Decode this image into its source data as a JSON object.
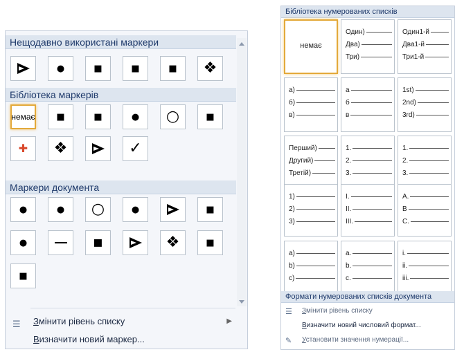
{
  "bullets": {
    "recent_header": "Нещодавно використані маркери",
    "library_header": "Бібліотека маркерів",
    "document_header": "Маркери документа",
    "none_label": "немає",
    "recent": [
      "triangle-open",
      "dot",
      "square",
      "square",
      "square",
      "diamond-cluster"
    ],
    "library": [
      "none",
      "square",
      "square",
      "dot",
      "circle",
      "square",
      "picture",
      "diamond-cluster",
      "triangle-open",
      "check"
    ],
    "document": [
      "dot",
      "dot",
      "circle",
      "dot",
      "triangle-open",
      "square",
      "dot",
      "dash",
      "small-square",
      "triangle-open",
      "diamond-cluster",
      "square",
      "square"
    ],
    "menu": {
      "change_level": {
        "underline": "З",
        "rest": "мінити рівень списку"
      },
      "define_new": {
        "underline": "В",
        "rest": "изначити новий маркер..."
      }
    }
  },
  "numbering": {
    "library_header": "Бібліотека нумерованих списків",
    "none_label": "немає",
    "formats_header": "Формати нумерованих списків документа",
    "cells": [
      {
        "type": "none"
      },
      {
        "type": "list",
        "lines": [
          "Один)",
          "Два)",
          "Три)"
        ]
      },
      {
        "type": "list",
        "lines": [
          "Один1-й",
          "Два1-й",
          "Три1-й"
        ]
      },
      {
        "type": "list",
        "lines": [
          "а)",
          "б)",
          "в)"
        ]
      },
      {
        "type": "list",
        "lines": [
          "а",
          "б",
          "в"
        ]
      },
      {
        "type": "list",
        "lines": [
          "1st)",
          "2nd)",
          "3rd)"
        ]
      },
      {
        "type": "list",
        "lines": [
          "Перший)",
          "Другий)",
          "Третій)"
        ]
      },
      {
        "type": "list",
        "lines": [
          "1.",
          "2.",
          "3."
        ]
      },
      {
        "type": "list",
        "lines": [
          "1.",
          "2.",
          "3."
        ]
      },
      {
        "type": "list",
        "lines": [
          "1)",
          "2)",
          "3)"
        ]
      },
      {
        "type": "list",
        "lines": [
          "I.",
          "II.",
          "III."
        ]
      },
      {
        "type": "list",
        "lines": [
          "A.",
          "B",
          "C."
        ]
      },
      {
        "type": "list",
        "lines": [
          "a)",
          "b)",
          "c)"
        ]
      },
      {
        "type": "list",
        "lines": [
          "a.",
          "b.",
          "c."
        ]
      },
      {
        "type": "list",
        "lines": [
          "i.",
          "ii.",
          "iii."
        ]
      }
    ],
    "menu": {
      "change_level": {
        "underline": "З",
        "rest": "мінити рівень списку"
      },
      "define_new": {
        "underline": "В",
        "rest": "изначити новий числовий формат..."
      },
      "set_value": {
        "underline": "У",
        "rest": "становити значення нумерації..."
      }
    }
  },
  "colors": {
    "header_bg": "#dde5ef",
    "header_text": "#1f3a6b",
    "selection": "#e3a93a"
  }
}
